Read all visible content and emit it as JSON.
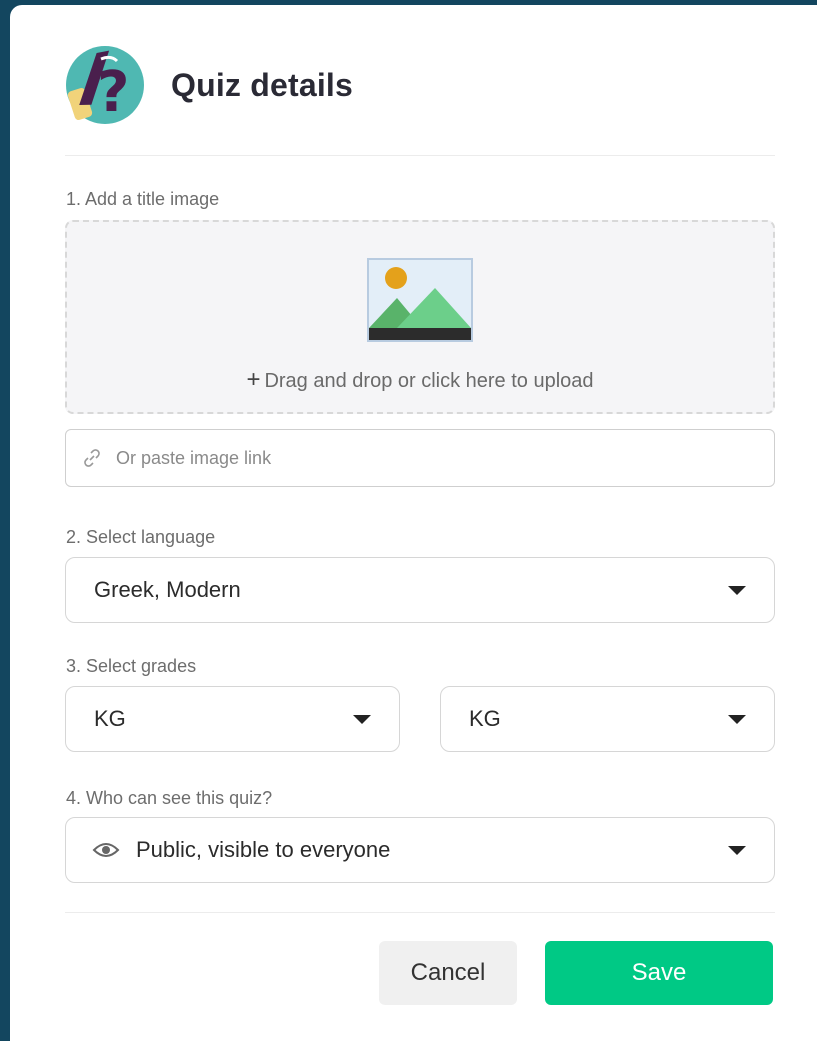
{
  "dialog": {
    "title": "Quiz details",
    "logo_icon": "quiz-question-pencil-icon"
  },
  "image_section": {
    "label": "1. Add a title image",
    "dropzone_text": "Drag and drop or click here to upload",
    "dropzone_icon": "image-placeholder-icon",
    "link_placeholder": "Or paste image link",
    "link_value": ""
  },
  "language_section": {
    "label": "2. Select language",
    "selected": "Greek, Modern"
  },
  "grades_section": {
    "label": "3. Select grades",
    "from": "KG",
    "to": "KG"
  },
  "visibility_section": {
    "label": "4. Who can see this quiz?",
    "selected": "Public, visible to everyone",
    "icon": "eye-icon"
  },
  "actions": {
    "cancel_label": "Cancel",
    "save_label": "Save"
  },
  "colors": {
    "primary": "#00c985",
    "backdrop": "#13465f",
    "logo_purple": "#4a1f4d",
    "logo_teal": "#4fb8b2"
  }
}
